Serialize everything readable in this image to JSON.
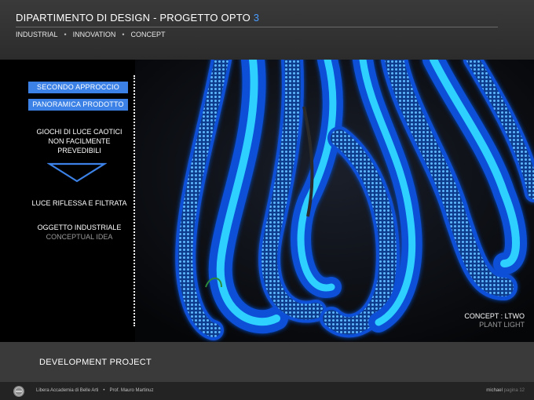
{
  "header": {
    "title_prefix": "DIPARTIMENTO DI DESIGN  -  PROGETTO OPTO ",
    "title_accent": "3",
    "nav": [
      "INDUSTRIAL",
      "INNOVATION",
      "CONCEPT"
    ],
    "nav_separator": "•"
  },
  "sidebar": {
    "button_1": "SECONDO APPROCCIO",
    "button_2": "PANORAMICA PRODOTTO",
    "text_1_lines": [
      "GIOCHI DI LUCE CAOTICI",
      "NON FACILMENTE",
      "PREVEDIBILI"
    ],
    "text_2": "LUCE RIFLESSA E FILTRATA",
    "text_3": "OGGETTO INDUSTRIALE",
    "text_3_sub": "CONCEPTUAL IDEA"
  },
  "concept": {
    "line_1": "CONCEPT :   LTWO",
    "line_2": "PLANT LIGHT"
  },
  "lower": {
    "label": "DEVELOPMENT PROJECT"
  },
  "footer": {
    "academy": "Libera Accademia di Belle Arti",
    "separator": "•",
    "professor": "Prof. Mauro Martinuz",
    "author": "michael",
    "page": "pagina 12"
  },
  "colors": {
    "accent": "#3c82e6",
    "glow": "#29c9ff"
  }
}
